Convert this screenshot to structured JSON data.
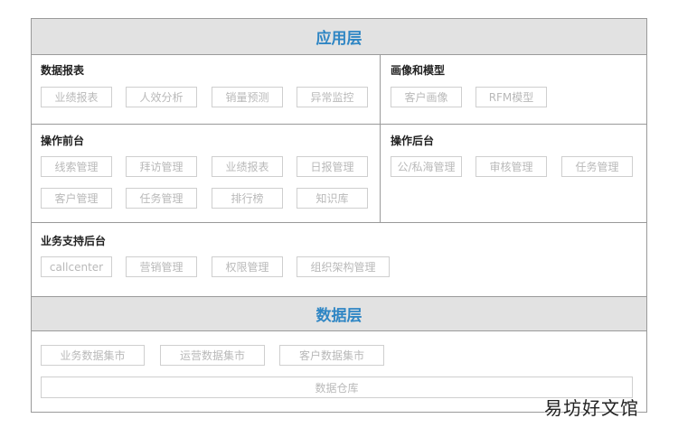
{
  "app_layer": {
    "title": "应用层",
    "data_reports": {
      "title": "数据报表",
      "items": [
        "业绩报表",
        "人效分析",
        "销量预测",
        "异常监控"
      ]
    },
    "portrait_models": {
      "title": "画像和模型",
      "items": [
        "客户画像",
        "RFM模型"
      ]
    },
    "operation_front": {
      "title": "操作前台",
      "items": [
        "线索管理",
        "拜访管理",
        "业绩报表",
        "日报管理",
        "客户管理",
        "任务管理",
        "排行榜",
        "知识库"
      ]
    },
    "operation_back": {
      "title": "操作后台",
      "items": [
        "公/私海管理",
        "审核管理",
        "任务管理"
      ]
    },
    "business_support": {
      "title": "业务支持后台",
      "items": [
        "callcenter",
        "营销管理",
        "权限管理",
        "组织架构管理"
      ]
    }
  },
  "data_layer": {
    "title": "数据层",
    "marts": [
      "业务数据集市",
      "运营数据集市",
      "客户数据集市"
    ],
    "warehouse": "数据仓库"
  },
  "watermark": "易坊好文馆"
}
